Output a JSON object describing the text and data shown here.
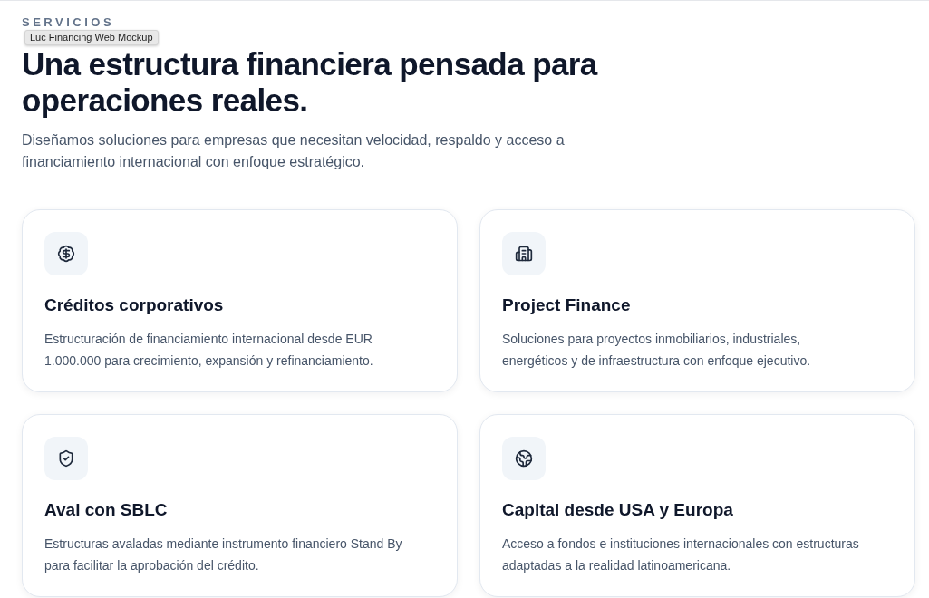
{
  "tooltip": "Luc Financing Web Mockup",
  "section": {
    "eyebrow": "SERVICIOS",
    "title": "Una estructura financiera pensada para operaciones reales.",
    "intro": "Diseñamos soluciones para empresas que necesitan velocidad, respaldo y acceso a financiamiento internacional con enfoque estratégico."
  },
  "cards": [
    {
      "title": "Créditos corporativos",
      "description": "Estructuración de financiamiento internacional desde EUR 1.000.000 para crecimiento, expansión y refinanciamiento."
    },
    {
      "title": "Project Finance",
      "description": "Soluciones para proyectos inmobiliarios, industriales, energéticos y de infraestructura con enfoque ejecutivo."
    },
    {
      "title": "Aval con SBLC",
      "description": "Estructuras avaladas mediante instrumento financiero Stand By para facilitar la aprobación del crédito."
    },
    {
      "title": "Capital desde USA y Europa",
      "description": "Acceso a fondos e instituciones internacionales con estructuras adaptadas a la realidad latinoamericana."
    }
  ]
}
